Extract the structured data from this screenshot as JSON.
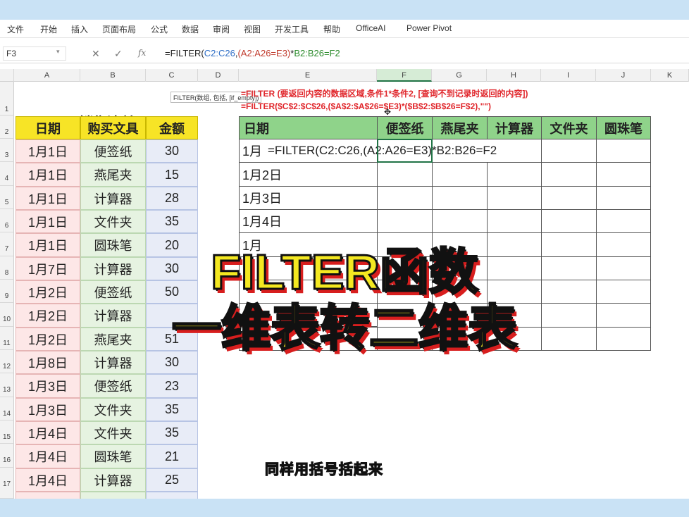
{
  "menu": [
    "文件",
    "开始",
    "插入",
    "页面布局",
    "公式",
    "数据",
    "审阅",
    "视图",
    "开发工具",
    "帮助",
    "OfficeAI",
    "Power Pivot"
  ],
  "name_box": "F3",
  "formula_bar": {
    "prefix": "=FILTER(",
    "r1": "C2:C26",
    "c1": ",",
    "r2": "(A2:A26=E3)",
    "op": "*",
    "r3": "B2:B26=F2",
    "fx": "fx"
  },
  "columns": [
    "A",
    "B",
    "C",
    "D",
    "E",
    "F",
    "G",
    "H",
    "I",
    "J",
    "K"
  ],
  "rows": [
    "1",
    "2",
    "3",
    "4",
    "5",
    "6",
    "7",
    "8",
    "9",
    "10",
    "11",
    "12",
    "13",
    "14",
    "15",
    "16",
    "17"
  ],
  "tooltip": "FILTER(数组, 包括, [if_empty])",
  "hint_lines": [
    "=FILTER (要返回内容的数据区域,条件1*条件2, [查询不到记录时返回的内容])",
    "=FILTER($C$2:$C$26,($A$2:$A$26=$E3)*($B$2:$B$26=F$2),\"\")"
  ],
  "sheet_title": "销售清单",
  "source_table": {
    "headers": [
      "日期",
      "购买文具",
      "金额"
    ],
    "rows": [
      [
        "1月1日",
        "便签纸",
        "30"
      ],
      [
        "1月1日",
        "燕尾夹",
        "15"
      ],
      [
        "1月1日",
        "计算器",
        "28"
      ],
      [
        "1月1日",
        "文件夹",
        "35"
      ],
      [
        "1月1日",
        "圆珠笔",
        "20"
      ],
      [
        "1月7日",
        "计算器",
        "30"
      ],
      [
        "1月2日",
        "便签纸",
        "50"
      ],
      [
        "1月2日",
        "计算器",
        ""
      ],
      [
        "1月2日",
        "燕尾夹",
        "51"
      ],
      [
        "1月8日",
        "计算器",
        "30"
      ],
      [
        "1月3日",
        "便签纸",
        "23"
      ],
      [
        "1月3日",
        "文件夹",
        "35"
      ],
      [
        "1月4日",
        "文件夹",
        "35"
      ],
      [
        "1月4日",
        "圆珠笔",
        "21"
      ],
      [
        "1月4日",
        "计算器",
        "25"
      ]
    ]
  },
  "result_table": {
    "headers": [
      "日期",
      "便签纸",
      "燕尾夹",
      "计算器",
      "文件夹",
      "圆珠笔"
    ],
    "dates": [
      "1月",
      "1月2日",
      "1月3日",
      "1月4日",
      "1月",
      "",
      ""
    ],
    "editing_formula": "=FILTER(C2:C26,(A2:A26=E3)*B2:B26=F2"
  },
  "overlay": {
    "line1": "FILTER函数",
    "line2": "一维表转二维表",
    "subtitle": "同样用括号括起来"
  },
  "colors": {
    "accent_yellow": "#f7e426",
    "header_green": "#8fd38a",
    "overlay_red": "#d81e1e"
  }
}
